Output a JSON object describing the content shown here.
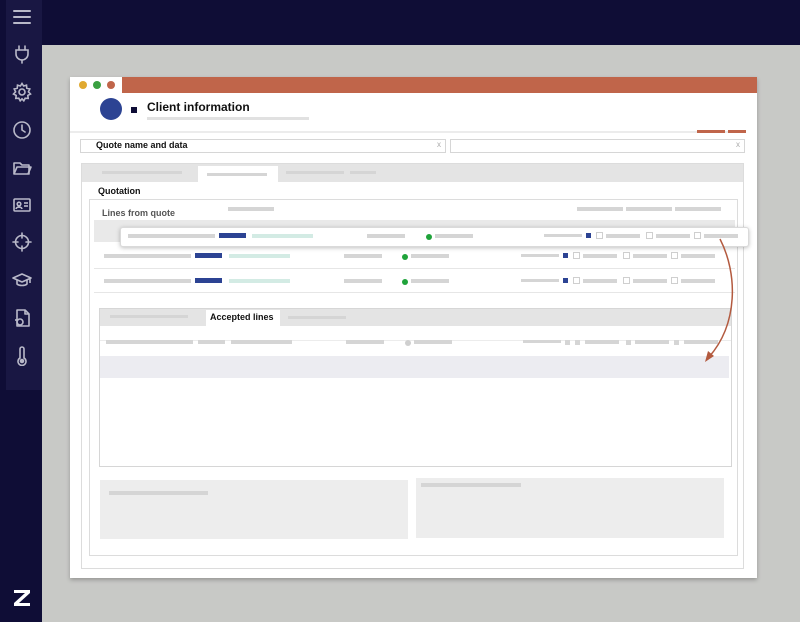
{
  "header": {
    "title": "Client information"
  },
  "quote": {
    "name_label": "Quote name and data",
    "clear_left": "x",
    "clear_right": "x"
  },
  "quotation": {
    "title": "Quotation",
    "lines_from_quote": "Lines from quote"
  },
  "accepted": {
    "tab_label": "Accepted lines"
  },
  "colors": {
    "nav_bg": "#0f0d36",
    "accent_orange": "#c0654a",
    "brand_blue": "#2c4393",
    "status_green": "#1fa33a"
  },
  "icons": [
    "menu-icon",
    "plug-icon",
    "gear-icon",
    "clock-icon",
    "folder-icon",
    "id-card-icon",
    "crosshair-icon",
    "graduation-cap-icon",
    "document-icon",
    "thermometer-icon",
    "brand-logo-icon"
  ]
}
